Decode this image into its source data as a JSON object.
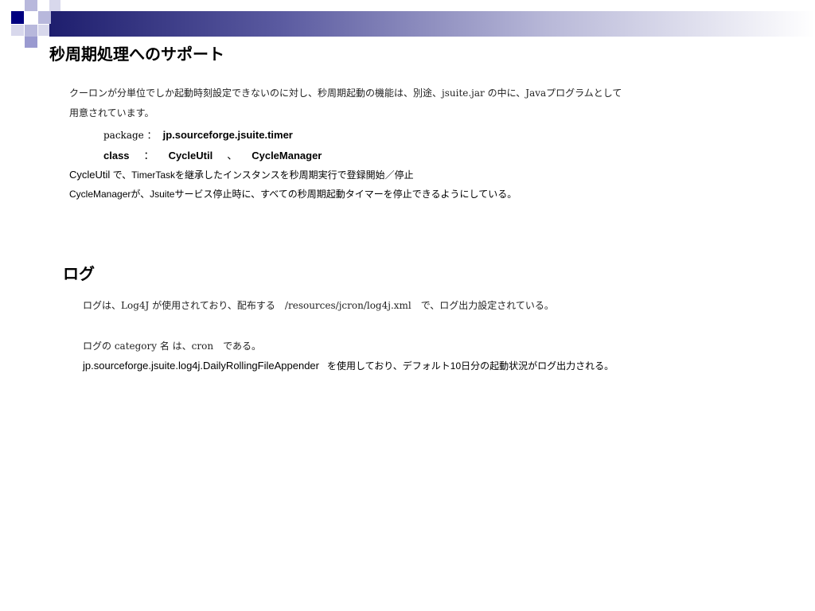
{
  "slide": {
    "title": "秒周期処理へのサポート",
    "intro_line1": "クーロンが分単位でしか起動時刻設定できないのに対し、秒周期起動の機能は、別途、jsuite.jar の中に、Javaプログラムとして",
    "intro_line2": "用意されています。",
    "package_label": "package ：",
    "package_value": "jp.sourceforge.jsuite.timer",
    "class_label": "class",
    "class_colon": "：",
    "class_1": "CycleUtil",
    "class_sep": "、",
    "class_2": "CycleManager",
    "cycleutil_name": "CycleUtil",
    "cycleutil_desc": " で、TimerTaskを継承したインスタンスを秒周期実行で登録開始／停止",
    "cyclemanager_desc": "CycleManagerが、Jsuiteサービス停止時に、すべての秒周期起動タイマーを停止できるようにしている。"
  },
  "log": {
    "heading": "ログ",
    "line1": "ログは、Log4J が使用されており、配布する　/resources/jcron/log4j.xml　で、ログ出力設定されている。",
    "line2": "ログの category 名 は、cron　である。",
    "appender_class": "jp.sourceforge.jsuite.log4j.DailyRollingFileAppender",
    "appender_desc": "を使用しており、デフォルト10日分の起動状況がログ出力される。"
  },
  "colors": {
    "accent_dark": "#000080",
    "accent_light": "#b8b8dc"
  }
}
